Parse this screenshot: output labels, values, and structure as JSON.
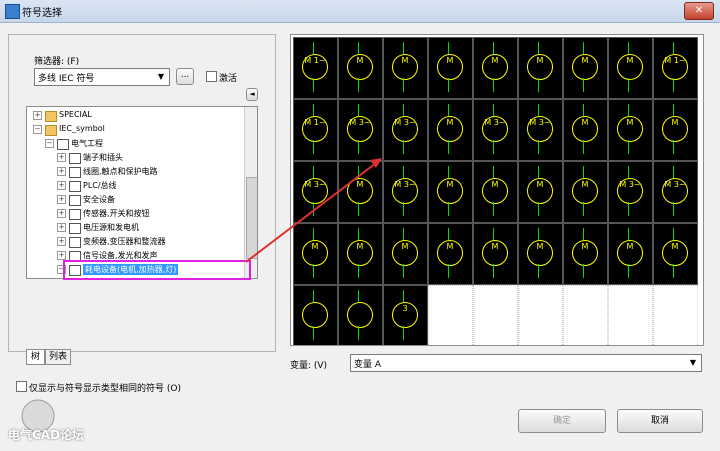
{
  "window": {
    "title": "符号选择",
    "close_label": "✕"
  },
  "left": {
    "filter_label": "筛选器: (F)",
    "filter_value": "多线 IEC 符号",
    "filter_button": "...",
    "activate_label": "激活",
    "tree": [
      {
        "label": "SPECIAL",
        "level": 0,
        "kind": "folder",
        "exp": "+"
      },
      {
        "label": "IEC_symbol",
        "level": 0,
        "kind": "folder",
        "exp": "−"
      },
      {
        "label": "电气工程",
        "level": 1,
        "kind": "doc",
        "exp": "−"
      },
      {
        "label": "端子和插头",
        "level": 2,
        "kind": "doc",
        "exp": "+"
      },
      {
        "label": "线圈,触点和保护电路",
        "level": 2,
        "kind": "doc",
        "exp": "+"
      },
      {
        "label": "PLC/总线",
        "level": 2,
        "kind": "doc",
        "exp": "+"
      },
      {
        "label": "安全设备",
        "level": 2,
        "kind": "doc",
        "exp": "+"
      },
      {
        "label": "传感器,开关和按钮",
        "level": 2,
        "kind": "doc",
        "exp": "+"
      },
      {
        "label": "电压源和发电机",
        "level": 2,
        "kind": "doc",
        "exp": "+"
      },
      {
        "label": "变频器,变压器和整流器",
        "level": 2,
        "kind": "doc",
        "exp": "+"
      },
      {
        "label": "信号设备,发光和发声",
        "level": 2,
        "kind": "doc",
        "exp": "+"
      },
      {
        "label": "耗电设备(电机,加热器,灯)",
        "level": 2,
        "kind": "doc",
        "exp": "−",
        "selected": true
      }
    ],
    "tabs": [
      "树",
      "列表"
    ],
    "only_same_type": "仅显示与符号显示类型相同的符号 (O)"
  },
  "right": {
    "variant_label": "变量: (V)",
    "variant_value": "变量 A"
  },
  "buttons": {
    "ok": "确定",
    "cancel": "取消"
  },
  "watermark": "电气CAD论坛",
  "grid": {
    "rows": [
      [
        "M 1~",
        "M",
        "M",
        "M",
        "M",
        "M",
        "M",
        "M",
        "M 1~"
      ],
      [
        "M 1~",
        "M 3~",
        "M 3~",
        "M",
        "M 3~",
        "M 3~",
        "M",
        "M",
        "M"
      ],
      [
        "M 3~",
        "M",
        "M 3~",
        "M",
        "M",
        "M",
        "M",
        "M 3~",
        "M 3~"
      ],
      [
        "M",
        "M",
        "M",
        "M",
        "M",
        "M",
        "M",
        "M",
        "M"
      ],
      [
        "",
        "",
        "3"
      ]
    ]
  }
}
